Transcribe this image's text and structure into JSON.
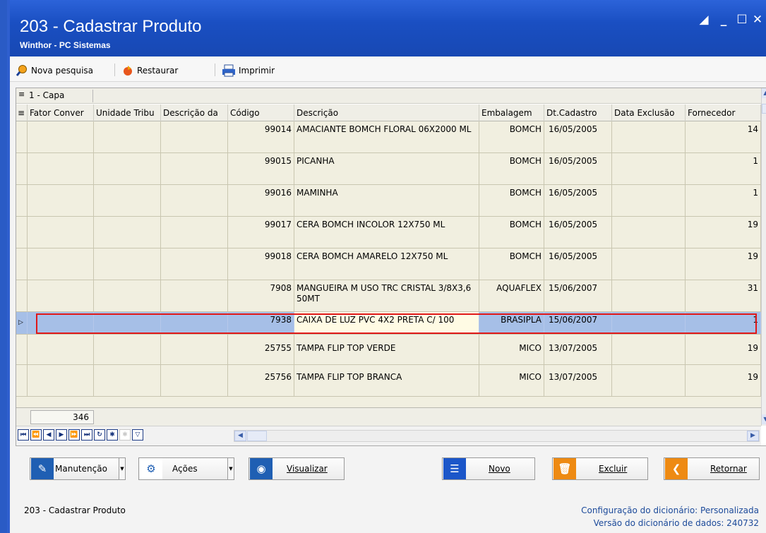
{
  "window": {
    "title": "203 - Cadastrar  Produto",
    "subtitle": "Winthor - PC Sistemas"
  },
  "toolbar": {
    "nova_pesquisa": "Nova pesquisa",
    "restaurar": "Restaurar",
    "imprimir": "Imprimir"
  },
  "grid": {
    "band": "1 - Capa",
    "columns": [
      "Fator Conver",
      "Unidade Tribu",
      "Descrição da",
      "Código",
      "Descrição",
      "Embalagem",
      "Dt.Cadastro",
      "Data Exclusão",
      "Fornecedor"
    ],
    "rows": [
      {
        "codigo": "99014",
        "descricao": "AMACIANTE BOMCH FLORAL 06X2000 ML",
        "embalagem": "BOMCH",
        "dt_cadastro": "16/05/2005",
        "data_exclusao": "",
        "fornecedor": "14"
      },
      {
        "codigo": "99015",
        "descricao": "PICANHA",
        "embalagem": "BOMCH",
        "dt_cadastro": "16/05/2005",
        "data_exclusao": "",
        "fornecedor": "1"
      },
      {
        "codigo": "99016",
        "descricao": "MAMINHA",
        "embalagem": "BOMCH",
        "dt_cadastro": "16/05/2005",
        "data_exclusao": "",
        "fornecedor": "1"
      },
      {
        "codigo": "99017",
        "descricao": "CERA BOMCH INCOLOR 12X750 ML",
        "embalagem": "BOMCH",
        "dt_cadastro": "16/05/2005",
        "data_exclusao": "",
        "fornecedor": "19"
      },
      {
        "codigo": "99018",
        "descricao": "CERA BOMCH AMARELO 12X750 ML",
        "embalagem": "BOMCH",
        "dt_cadastro": "16/05/2005",
        "data_exclusao": "",
        "fornecedor": "19"
      },
      {
        "codigo": "7908",
        "descricao": "MANGUEIRA M USO TRC CRISTAL 3/8X3,6 50MT",
        "embalagem": "AQUAFLEX",
        "dt_cadastro": "15/06/2007",
        "data_exclusao": "",
        "fornecedor": "31"
      },
      {
        "codigo": "7938",
        "descricao": "CAIXA DE LUZ PVC 4X2 PRETA C/ 100",
        "embalagem": "BRASIPLA",
        "dt_cadastro": "15/06/2007",
        "data_exclusao": "",
        "fornecedor": "1"
      },
      {
        "codigo": "25755",
        "descricao": "TAMPA FLIP TOP VERDE",
        "embalagem": "MICO",
        "dt_cadastro": "13/07/2005",
        "data_exclusao": "",
        "fornecedor": "19"
      },
      {
        "codigo": "25756",
        "descricao": "TAMPA FLIP TOP BRANCA",
        "embalagem": "MICO",
        "dt_cadastro": "13/07/2005",
        "data_exclusao": "",
        "fornecedor": "19"
      }
    ],
    "selected_row_index": 6,
    "record_count": "346"
  },
  "actions": {
    "manutencao": "Manutenção",
    "acoes": "Ações",
    "visualizar": "Visualizar",
    "novo": "Novo",
    "excluir": "Excluir",
    "retornar": "Retornar"
  },
  "status": {
    "left": "203 - Cadastrar  Produto",
    "config": "Configuração do dicionário: Personalizada",
    "versao": "Versão do dicionário de dados: 240732"
  },
  "colors": {
    "titlebar": "#1a4fc2",
    "selected_row": "#a6bfe7",
    "highlight_border": "#e01818",
    "manutencao_icon": "#1f5fb3",
    "novo_icon": "#1b56c9",
    "excluir_icon": "#ee8a12",
    "retornar_icon": "#ee8a12"
  }
}
